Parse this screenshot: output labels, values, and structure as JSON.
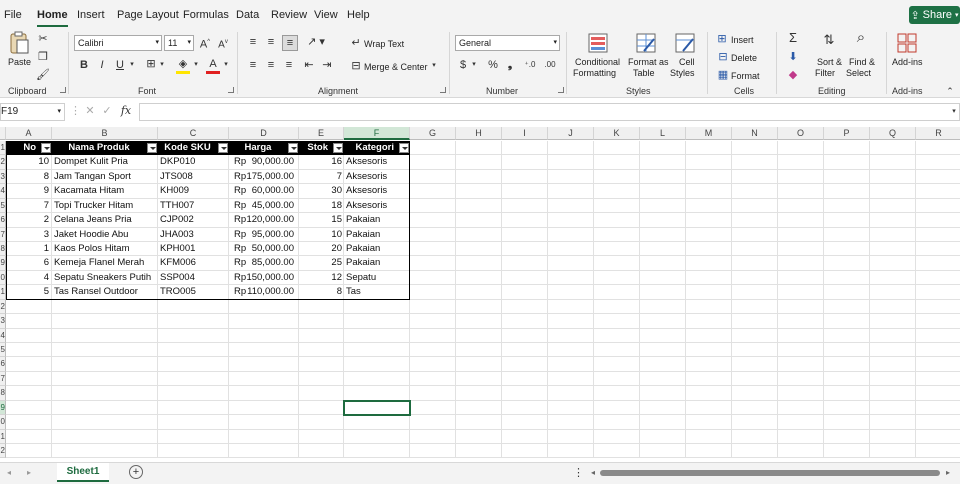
{
  "menu": {
    "tabs": [
      "File",
      "Home",
      "Insert",
      "Page Layout",
      "Formulas",
      "Data",
      "Review",
      "View",
      "Help"
    ],
    "active": "Home",
    "share_label": "Share"
  },
  "ribbon": {
    "clipboard": {
      "paste": "Paste",
      "group": "Clipboard"
    },
    "font": {
      "family": "Calibri",
      "size": "11",
      "group": "Font"
    },
    "alignment": {
      "wrap": "Wrap Text",
      "merge": "Merge & Center",
      "group": "Alignment"
    },
    "number": {
      "format": "General",
      "group": "Number"
    },
    "styles": {
      "conditional_1": "Conditional",
      "conditional_2": "Formatting",
      "format_table_1": "Format as",
      "format_table_2": "Table",
      "cell_styles_1": "Cell",
      "cell_styles_2": "Styles",
      "group": "Styles"
    },
    "cells": {
      "insert": "Insert",
      "delete": "Delete",
      "format": "Format",
      "group": "Cells"
    },
    "editing": {
      "sort_1": "Sort &",
      "sort_2": "Filter",
      "find_1": "Find &",
      "find_2": "Select",
      "group": "Editing"
    },
    "addins": {
      "label": "Add-ins",
      "group": "Add-ins"
    }
  },
  "formula_bar": {
    "name_box": "F19",
    "fx": "fx",
    "value": ""
  },
  "columns": [
    "A",
    "B",
    "C",
    "D",
    "E",
    "F",
    "G",
    "H",
    "I",
    "J",
    "K",
    "L",
    "M",
    "N",
    "O",
    "P",
    "Q",
    "R"
  ],
  "selected_column": "F",
  "selected_row": "19",
  "row_numbers": [
    "1",
    "2",
    "3",
    "4",
    "5",
    "6",
    "7",
    "8",
    "9",
    "0",
    "1",
    "2",
    "3",
    "4",
    "5",
    "6",
    "7",
    "8",
    "9",
    "0",
    "1",
    "2"
  ],
  "table": {
    "headers": [
      "No",
      "Nama Produk",
      "Kode SKU",
      "Harga",
      "Stok",
      "Kategori"
    ],
    "rows": [
      [
        "10",
        "Dompet Kulit Pria",
        "DKP010",
        "Rp",
        "90,000.00",
        "16",
        "Aksesoris"
      ],
      [
        "8",
        "Jam Tangan Sport",
        "JTS008",
        "Rp",
        "175,000.00",
        "7",
        "Aksesoris"
      ],
      [
        "9",
        "Kacamata Hitam",
        "KH009",
        "Rp",
        "60,000.00",
        "30",
        "Aksesoris"
      ],
      [
        "7",
        "Topi Trucker Hitam",
        "TTH007",
        "Rp",
        "45,000.00",
        "18",
        "Aksesoris"
      ],
      [
        "2",
        "Celana Jeans Pria",
        "CJP002",
        "Rp",
        "120,000.00",
        "15",
        "Pakaian"
      ],
      [
        "3",
        "Jaket Hoodie Abu",
        "JHA003",
        "Rp",
        "95,000.00",
        "10",
        "Pakaian"
      ],
      [
        "1",
        "Kaos Polos Hitam",
        "KPH001",
        "Rp",
        "50,000.00",
        "20",
        "Pakaian"
      ],
      [
        "6",
        "Kemeja Flanel Merah",
        "KFM006",
        "Rp",
        "85,000.00",
        "25",
        "Pakaian"
      ],
      [
        "4",
        "Sepatu Sneakers Putih",
        "SSP004",
        "Rp",
        "150,000.00",
        "12",
        "Sepatu"
      ],
      [
        "5",
        "Tas Ransel Outdoor",
        "TRO005",
        "Rp",
        "110,000.00",
        "8",
        "Tas"
      ]
    ]
  },
  "sheet": {
    "tab": "Sheet1"
  },
  "colors": {
    "accent": "#1e7145",
    "header_bg": "#000000"
  }
}
